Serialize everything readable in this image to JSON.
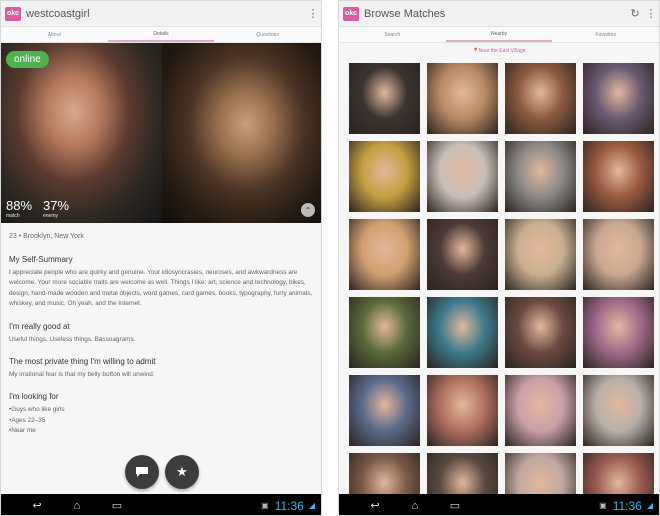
{
  "left_screen": {
    "app_icon_text": "okc",
    "username": "westcoastgirl",
    "overflow_icon": "⋮",
    "tabs": [
      "About",
      "Details",
      "Questions"
    ],
    "online_label": "online",
    "match": {
      "value": "88%",
      "label": "match"
    },
    "enemy": {
      "value": "37%",
      "label": "enemy"
    },
    "location": "23 • Brooklyn, New York",
    "sections": [
      {
        "heading": "My Self-Summary",
        "text": "I appreciate people who are quirky and genuine. Your idiosyncrasies, neuroses, and awkwardness are welcome. Your more sociable traits are welcome as well. Things I like: art, science and technology, bikes, design, hand-made wooden and metal objects, word games, card games, books, typography, furry animals, whiskey, and music. Oh yeah, and the Internet."
      },
      {
        "heading": "I'm really good at",
        "text": "Useful things. Useless things. Bassoagrams."
      },
      {
        "heading": "The most private thing I'm willing to admit",
        "text": "My irrational fear is that my belly button will unwind."
      },
      {
        "heading": "I'm looking for",
        "text": "•Guys who like girls\n•Ages 22–35\n•Near me"
      }
    ],
    "fab_chat_icon": "chat-bubble-icon",
    "fab_star_icon": "star-icon"
  },
  "right_screen": {
    "app_icon_text": "okc",
    "title": "Browse Matches",
    "tabs": [
      "Search",
      "Nearby",
      "Favorites"
    ],
    "near_text": "Near the East Village",
    "refresh_icon": "↻",
    "overflow_icon": "⋮",
    "tile_colors": [
      [
        "#3b3330",
        "#b88a64",
        "#8a5a3e",
        "#6a5a72"
      ],
      [
        "#c4a040",
        "#c9bfb8",
        "#8b8a88",
        "#9a5a40"
      ],
      [
        "#d0a070",
        "#4c3a36",
        "#c8b090",
        "#c7a890"
      ],
      [
        "#5a6a3a",
        "#3c7a8a",
        "#6a4a40",
        "#a06a8a"
      ],
      [
        "#5a6a8a",
        "#b07060",
        "#c9a0a8",
        "#b8b0a8"
      ],
      [
        "#7a5a48",
        "#5a4a40",
        "#c0a8a0",
        "#9a5a50"
      ]
    ]
  },
  "status_bar": {
    "time": "11:36"
  }
}
